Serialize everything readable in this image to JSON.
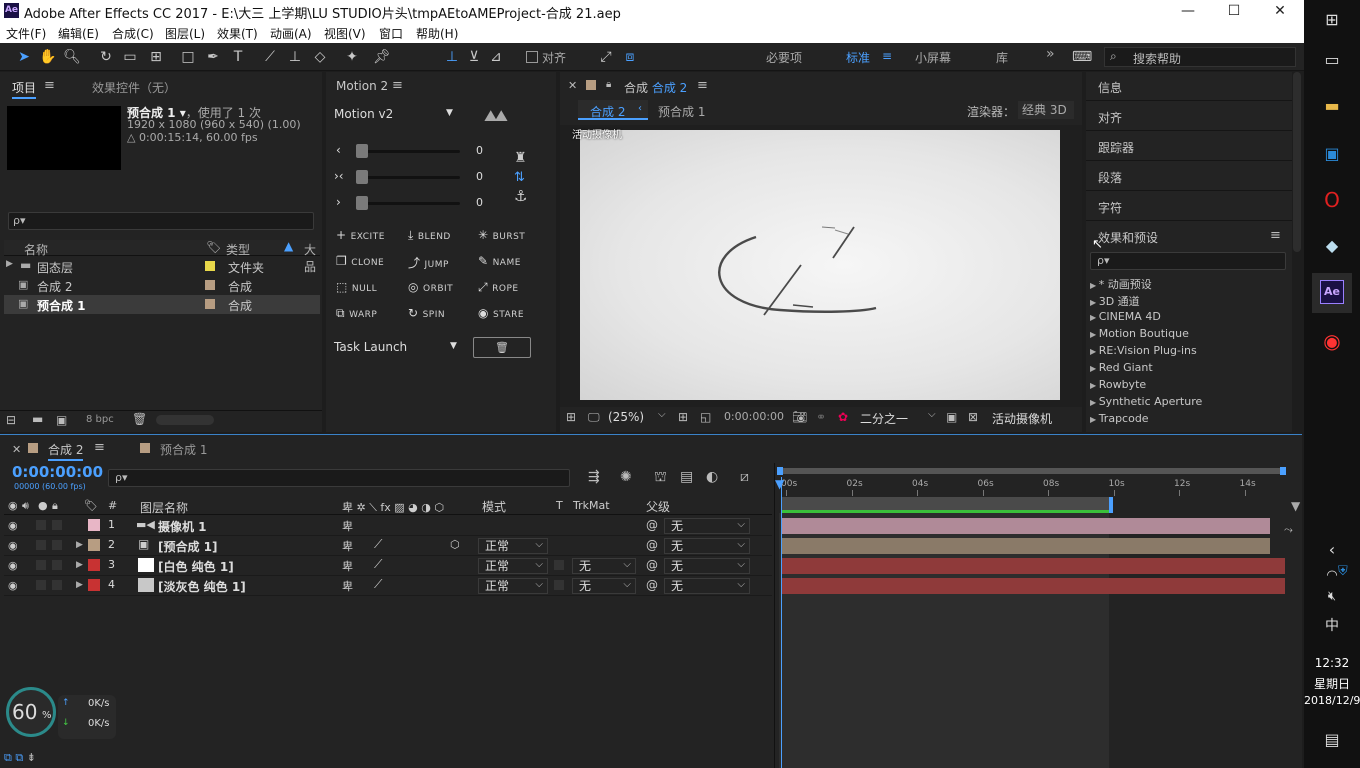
{
  "window": {
    "app_icon": "Ae",
    "title": "Adobe After Effects CC 2017 - E:\\大三 上学期\\LU STUDIO片头\\tmpAEtoAMEProject-合成 21.aep",
    "min": "—",
    "max": "☐",
    "close": "✕"
  },
  "menu": [
    "文件(F)",
    "编辑(E)",
    "合成(C)",
    "图层(L)",
    "效果(T)",
    "动画(A)",
    "视图(V)",
    "窗口",
    "帮助(H)"
  ],
  "toolbar": {
    "align_label": "对齐",
    "workspaces": [
      "必要项",
      "标准",
      "小屏幕",
      "库"
    ],
    "active_workspace": "标准",
    "more": "»",
    "search_placeholder": "搜索帮助"
  },
  "project": {
    "tab": "项目",
    "tab_menu": "≡",
    "effect_controls_tab": "效果控件（无）",
    "selected_name": "预合成 1 ▾",
    "used": "，使用了 1 次",
    "dims": "1920 x 1080  (960 x 540) (1.00)",
    "duration": "△ 0:00:15:14, 60.00 fps",
    "search_placeholder": "ρ▾",
    "col_name": "名称",
    "col_type": "类型",
    "col_size": "大",
    "items": [
      {
        "name": "固态层",
        "type": "文件夹",
        "color": "#e8d84a"
      },
      {
        "name": "合成 2",
        "type": "合成",
        "color": "#b79d82"
      },
      {
        "name": "预合成 1",
        "type": "合成",
        "color": "#b79d82"
      }
    ],
    "bpc": "8 bpc"
  },
  "motion": {
    "tab": "Motion 2",
    "preset": "Motion v2",
    "sliders": [
      {
        "icon": "‹",
        "value": "0"
      },
      {
        "icon": "›‹",
        "value": "0"
      },
      {
        "icon": "›",
        "value": "0"
      }
    ],
    "buttons": [
      {
        "icon": "+",
        "label": "EXCITE"
      },
      {
        "icon": "⤓",
        "label": "BLEND"
      },
      {
        "icon": "✳",
        "label": "BURST"
      },
      {
        "icon": "❐",
        "label": "CLONE"
      },
      {
        "icon": "⤴",
        "label": "JUMP"
      },
      {
        "icon": "✎",
        "label": "NAME"
      },
      {
        "icon": "⬚",
        "label": "NULL"
      },
      {
        "icon": "◎",
        "label": "ORBIT"
      },
      {
        "icon": "⤢",
        "label": "ROPE"
      },
      {
        "icon": "⧉",
        "label": "WARP"
      },
      {
        "icon": "↻",
        "label": "SPIN"
      },
      {
        "icon": "◉",
        "label": "STARE"
      }
    ],
    "task": "Task Launch",
    "trash": "🗑"
  },
  "comp": {
    "tab": "合成",
    "tab_name": "合成 2",
    "breadcrumb_active": "合成 2",
    "breadcrumb_other": "预合成 1",
    "renderer_label": "渲染器：",
    "renderer": "经典 3D",
    "camera_label": "活动摄像机",
    "zoom": "(25%)",
    "timecode": "0:00:00:00",
    "resolution": "二分之一",
    "view_camera": "活动摄像机"
  },
  "right": {
    "items": [
      "信息",
      "对齐",
      "跟踪器",
      "段落",
      "字符"
    ],
    "effects_title": "效果和预设",
    "search_placeholder": "ρ▾",
    "effects": [
      "* 动画预设",
      "3D 通道",
      "CINEMA 4D",
      "Motion Boutique",
      "RE:Vision Plug-ins",
      "Red Giant",
      "Rowbyte",
      "Synthetic Aperture",
      "Trapcode"
    ]
  },
  "timeline": {
    "tab_active": "合成 2",
    "tab_other": "预合成 1",
    "timecode": "0:00:00:00",
    "frames": "00000 (60.00 fps)",
    "col_layer_name": "图层名称",
    "col_mode": "模式",
    "col_t": "T",
    "col_trkmat": "TrkMat",
    "col_parent": "父级",
    "ruler": [
      "00s",
      "02s",
      "04s",
      "06s",
      "08s",
      "10s",
      "12s",
      "14s"
    ],
    "layers": [
      {
        "num": "1",
        "name": "摄像机 1",
        "label_color": "#e8b6c6",
        "mode": "",
        "trkmat": "",
        "parent": "无",
        "bar_color": "#b08a98",
        "bar_end": 0.97
      },
      {
        "num": "2",
        "name": "[预合成 1]",
        "label_color": "#b79d82",
        "mode": "正常",
        "trkmat": "",
        "parent": "无",
        "bar_color": "#8a7a68",
        "bar_end": 0.97
      },
      {
        "num": "3",
        "name": "[白色 纯色 1]",
        "label_color": "#c83232",
        "mode": "正常",
        "trkmat": "无",
        "parent": "无",
        "bar_color": "#8f3a3a",
        "bar_end": 1.0
      },
      {
        "num": "4",
        "name": "[淡灰色 纯色 1]",
        "label_color": "#c83232",
        "mode": "正常",
        "trkmat": "无",
        "parent": "无",
        "bar_color": "#8f3a3a",
        "bar_end": 1.0
      }
    ],
    "perf_value": "60",
    "perf_unit": "%",
    "up_speed": "0K/s",
    "down_speed": "0K/s"
  },
  "taskbar": {
    "time": "12:32",
    "weekday": "星期日",
    "date": "2018/12/9",
    "ime": "中"
  }
}
